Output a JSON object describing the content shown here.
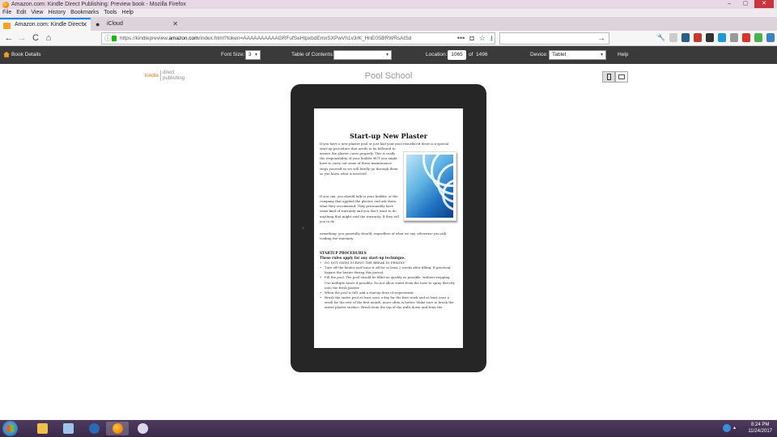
{
  "window": {
    "title": "Amazon.com: Kindle Direct Publishing: Preview book - Mozilla Firefox",
    "controls": [
      "–",
      "▢",
      "✕"
    ]
  },
  "menu": [
    "File",
    "Edit",
    "View",
    "History",
    "Bookmarks",
    "Tools",
    "Help"
  ],
  "tabs": [
    {
      "label": "Amazon.com: Kindle Direct Pu",
      "close": "✕"
    },
    {
      "label": "iCloud",
      "close": "✕"
    }
  ],
  "nav": {
    "back": "←",
    "forward": "→",
    "reload": "C",
    "home": "⌂",
    "url_prefix": "https://kindlepreview.",
    "url_host": "amazon.com",
    "url_rest": "/index.html?token=AAAAAAAAAAGRFufSeHtpxbdEmxSXPwVh1v3rK_HnE0SBRWRsAtSd",
    "more": "•••",
    "pocket": "◘",
    "bookmark": "☆",
    "download": "⭳",
    "search_go": "→"
  },
  "kdp": {
    "book_details": "Book Details",
    "font_size_label": "Font Size:",
    "font_size_value": "3",
    "toc_label": "Table of Contents:",
    "toc_value": "",
    "location_label": "Location:",
    "location_value": "1065",
    "location_of": "of",
    "location_total": "1496",
    "device_label": "Device:",
    "device_value": "Tablet",
    "help": "Help"
  },
  "content": {
    "logo_kindle": "kindle",
    "logo_direct": "direct",
    "logo_publishing": "publishing",
    "book_title": "Pool School"
  },
  "page": {
    "heading": "Start-up New Plaster",
    "intro": "If you have a new plaster pool or just had your pool resurfaced there is a special",
    "para1": "start-up procedure that needs to be followed to ensure the plaster cures properly. This is really the responsibility of your builder BUT you might have to carry out some of these maintenance steps yourself so we will briefly go through them so you know what is involved.",
    "para2": "If you can, you should talk to your builder, or the company that applied the plaster, and ask them what they recommend. They presumably have some kind of warranty and you don't want to do anything that might void the warranty. If they tell you to do",
    "para2_full": "something, you generally should, regardless of what we say, otherwise you risk voiding the warranty.",
    "section_title": "STARTUP PROCEDURES",
    "section_sub": "These rules apply for any start-up technique.",
    "bullets": [
      "DO NOT SWIM DURING THE BREAK IN PERIOD!",
      "Turn off the heater and leave it off for at least 2 weeks after filling. If practical, bypass the heater during this period.",
      "Fill the pool. The pool should be filled as quickly as possible, without stopping. Use multiple hoses if possible. Do not allow water from the hose to spray directly onto the fresh plaster.",
      "When the pool is full, add a startup dose of sequestrant.",
      "Brush the entire pool at least once a day for the first week and at least once a week for the rest of the first month, more often is better. Make sure to brush the entire plaster surface. Brush from the top of the walls down and from the"
    ]
  },
  "taskbar": {
    "time": "8:24 PM",
    "date": "11/24/2017"
  },
  "colors": {
    "kdp_bar": "#3a3a3a",
    "kindle_orange": "#e47911",
    "tab_accent": "#0a84ff",
    "tablet_bezel": "#262626"
  }
}
